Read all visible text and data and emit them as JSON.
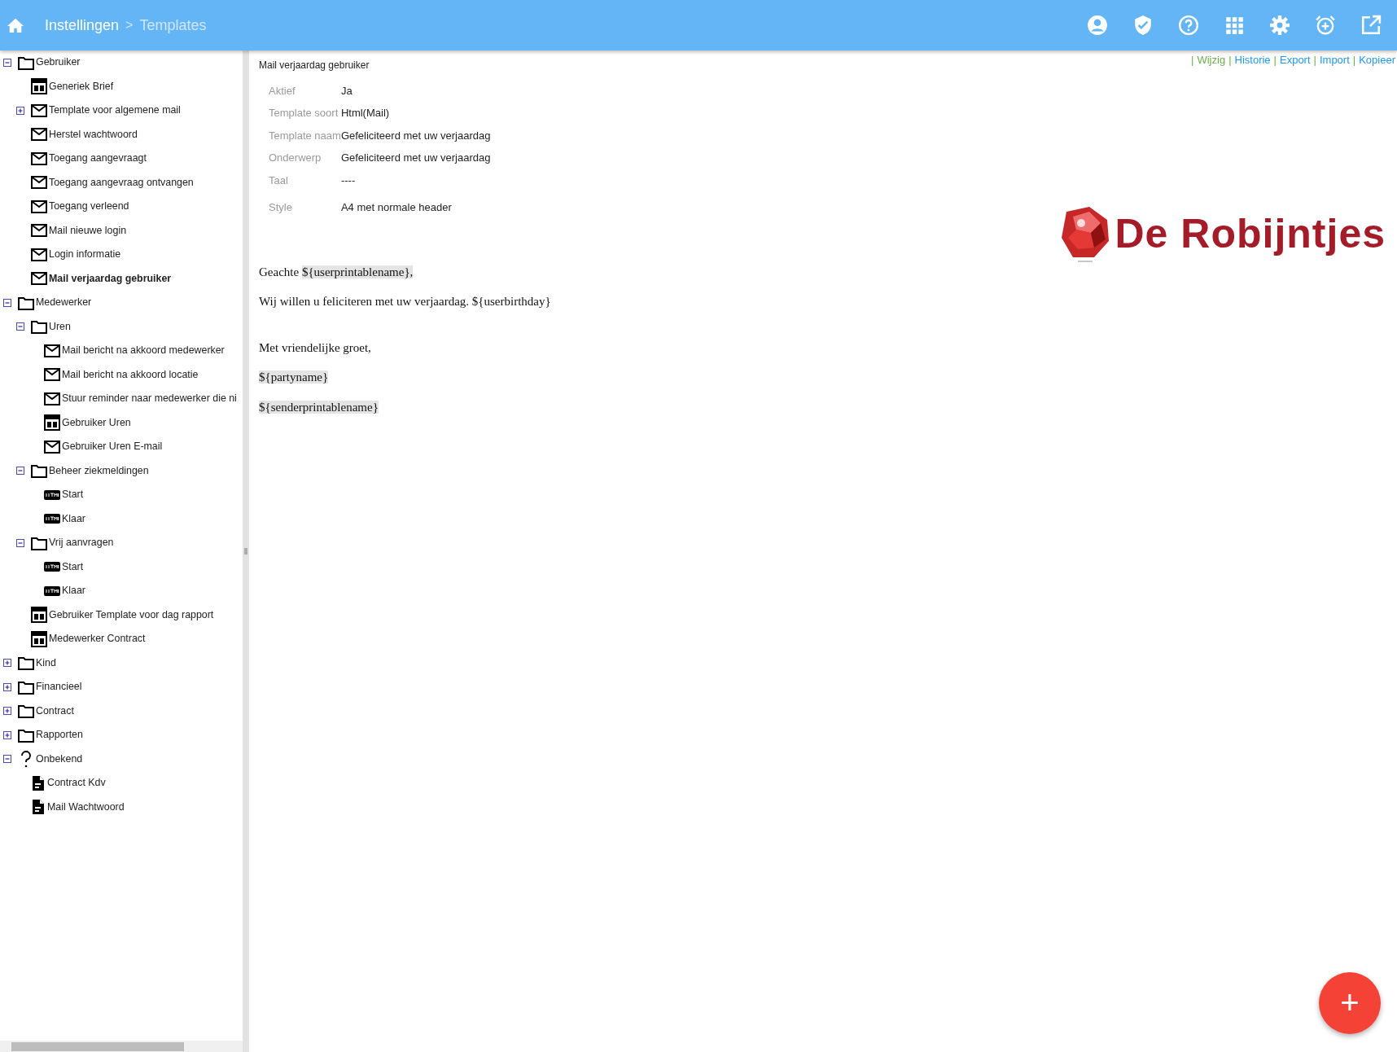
{
  "topbar": {
    "breadcrumb": [
      {
        "label": "Instellingen",
        "current": false
      },
      {
        "label": "Templates",
        "current": true
      }
    ],
    "separator": ">"
  },
  "tree": [
    {
      "label": "Gebruiker",
      "kind": "folder",
      "expanded": true,
      "selected": false,
      "children": [
        {
          "label": "Generiek Brief",
          "kind": "layout",
          "selected": false
        },
        {
          "label": "Template voor algemene mail",
          "kind": "mail",
          "expanded": false,
          "selected": false
        },
        {
          "label": "Herstel wachtwoord",
          "kind": "mail",
          "selected": false
        },
        {
          "label": "Toegang aangevraagt",
          "kind": "mail",
          "selected": false
        },
        {
          "label": "Toegang aangevraag ontvangen",
          "kind": "mail",
          "selected": false
        },
        {
          "label": "Toegang verleend",
          "kind": "mail",
          "selected": false
        },
        {
          "label": "Mail nieuwe login",
          "kind": "mail",
          "selected": false
        },
        {
          "label": "Login informatie",
          "kind": "mail",
          "selected": false
        },
        {
          "label": "Mail verjaardag gebruiker",
          "kind": "mail",
          "selected": true
        }
      ]
    },
    {
      "label": "Medewerker",
      "kind": "folder",
      "expanded": true,
      "selected": false,
      "children": [
        {
          "label": "Uren",
          "kind": "folder",
          "expanded": true,
          "selected": false,
          "children": [
            {
              "label": "Mail bericht na akkoord medewerker",
              "kind": "mail",
              "selected": false
            },
            {
              "label": "Mail bericht na akkoord locatie",
              "kind": "mail",
              "selected": false
            },
            {
              "label": "Stuur reminder naar medewerker die ni",
              "kind": "mail",
              "selected": false
            },
            {
              "label": "Gebruiker Uren",
              "kind": "layout",
              "selected": false
            },
            {
              "label": "Gebruiker Uren E-mail",
              "kind": "mail",
              "selected": false
            }
          ]
        },
        {
          "label": "Beheer ziekmeldingen",
          "kind": "folder",
          "expanded": true,
          "selected": false,
          "children": [
            {
              "label": "Start",
              "kind": "html",
              "selected": false
            },
            {
              "label": "Klaar",
              "kind": "html",
              "selected": false
            }
          ]
        },
        {
          "label": "Vrij aanvragen",
          "kind": "folder",
          "expanded": true,
          "selected": false,
          "children": [
            {
              "label": "Start",
              "kind": "html",
              "selected": false
            },
            {
              "label": "Klaar",
              "kind": "html",
              "selected": false
            }
          ]
        },
        {
          "label": "Gebruiker Template voor dag rapport",
          "kind": "layout",
          "selected": false
        },
        {
          "label": "Medewerker Contract",
          "kind": "layout",
          "selected": false
        }
      ]
    },
    {
      "label": "Kind",
      "kind": "folder",
      "expanded": false,
      "selected": false
    },
    {
      "label": "Financieel",
      "kind": "folder",
      "expanded": false,
      "selected": false
    },
    {
      "label": "Contract",
      "kind": "folder",
      "expanded": false,
      "selected": false
    },
    {
      "label": "Rapporten",
      "kind": "folder",
      "expanded": false,
      "selected": false
    },
    {
      "label": "Onbekend",
      "kind": "unknown",
      "expanded": true,
      "selected": false,
      "children": [
        {
          "label": "Contract Kdv",
          "kind": "document",
          "selected": false
        },
        {
          "label": "Mail Wachtwoord",
          "kind": "document",
          "selected": false
        }
      ]
    }
  ],
  "detail": {
    "title": "Mail verjaardag gebruiker",
    "actions": [
      {
        "separator": "|",
        "label": "Wijzig",
        "color": "#6ab04c"
      },
      {
        "separator": "|",
        "label": "Historie",
        "color": "#2196f3"
      },
      {
        "separator": "|",
        "label": "Export",
        "color": "#2196f3"
      },
      {
        "separator": "|",
        "label": "Import",
        "color": "#2196f3"
      },
      {
        "separator": "|",
        "label": "Kopieer",
        "color": "#2196f3"
      }
    ],
    "properties": [
      {
        "label": "Aktief",
        "value": "Ja"
      },
      {
        "label": "Template soort",
        "value": "Html(Mail)"
      },
      {
        "label": "Template naam",
        "value": "Gefeliciteerd met uw verjaardag"
      },
      {
        "label": "Onderwerp",
        "value": "Gefeliciteerd met uw verjaardag"
      },
      {
        "label": "Taal",
        "value": "----"
      },
      {
        "label": "Style",
        "value": "A4 met normale header"
      }
    ],
    "logo": {
      "text": "De Robijntjes"
    },
    "letter": [
      {
        "kind": "line",
        "parts": [
          {
            "text": "Geachte ",
            "variable": false
          },
          {
            "text": "${userprintablename},",
            "variable": true
          }
        ]
      },
      {
        "kind": "line",
        "parts": [
          {
            "text": "Wij willen u feliciteren met uw verjaardag. ${userbirthday}",
            "variable": false
          }
        ]
      },
      {
        "kind": "blank"
      },
      {
        "kind": "line",
        "parts": [
          {
            "text": "Met vriendelijke groet,",
            "variable": false
          }
        ]
      },
      {
        "kind": "line",
        "parts": [
          {
            "text": "${partyname}",
            "variable": true
          }
        ]
      },
      {
        "kind": "line",
        "parts": [
          {
            "text": "${senderprintablename}",
            "variable": true
          }
        ]
      }
    ]
  },
  "fab": {
    "label": "+"
  }
}
